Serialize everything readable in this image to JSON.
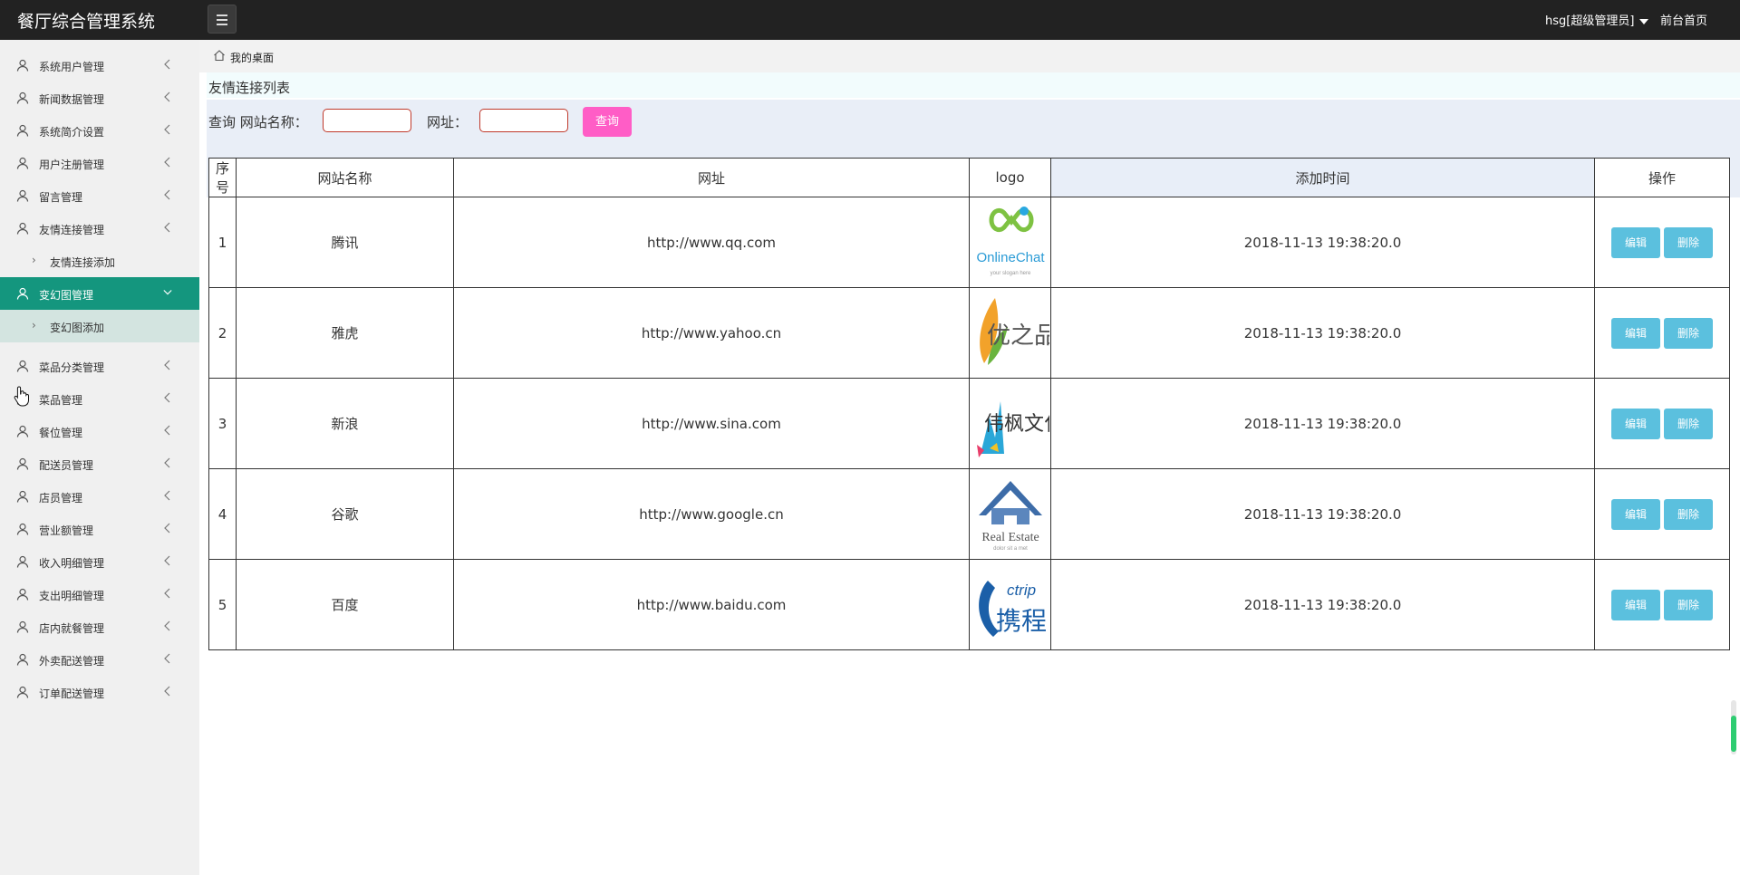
{
  "app": {
    "title": "餐厅综合管理系统"
  },
  "header": {
    "user_label": "hsg[超级管理员]",
    "home_link": "前台首页"
  },
  "sidebar": {
    "items": [
      {
        "label": "系统用户管理"
      },
      {
        "label": "新闻数据管理"
      },
      {
        "label": "系统简介设置"
      },
      {
        "label": "用户注册管理"
      },
      {
        "label": "留言管理"
      },
      {
        "label": "友情连接管理"
      },
      {
        "label": "友情连接添加",
        "sub": true
      },
      {
        "label": "变幻图管理",
        "active": true
      },
      {
        "label": "变幻图添加",
        "sub": true
      },
      {
        "label": "菜品分类管理"
      },
      {
        "label": "菜品管理"
      },
      {
        "label": "餐位管理"
      },
      {
        "label": "配送员管理"
      },
      {
        "label": "店员管理"
      },
      {
        "label": "营业额管理"
      },
      {
        "label": "收入明细管理"
      },
      {
        "label": "支出明细管理"
      },
      {
        "label": "店内就餐管理"
      },
      {
        "label": "外卖配送管理"
      },
      {
        "label": "订单配送管理"
      }
    ]
  },
  "breadcrumb": {
    "label": "我的桌面"
  },
  "list": {
    "title": "友情连接列表"
  },
  "search": {
    "prefix": "查询 网站名称：",
    "url_label": "网址：",
    "button": "查询"
  },
  "table": {
    "headers": [
      "序号",
      "网站名称",
      "网址",
      "logo",
      "添加时间",
      "操作"
    ],
    "rows": [
      {
        "no": "1",
        "name": "腾讯",
        "url": "http://www.qq.com",
        "logo": "OnlineChat",
        "time": "2018-11-13 19:38:20.0"
      },
      {
        "no": "2",
        "name": "雅虎",
        "url": "http://www.yahoo.cn",
        "logo": "优之品",
        "time": "2018-11-13 19:38:20.0"
      },
      {
        "no": "3",
        "name": "新浪",
        "url": "http://www.sina.com",
        "logo": "伟枫文化",
        "time": "2018-11-13 19:38:20.0"
      },
      {
        "no": "4",
        "name": "谷歌",
        "url": "http://www.google.cn",
        "logo": "Real Estate",
        "time": "2018-11-13 19:38:20.0"
      },
      {
        "no": "5",
        "name": "百度",
        "url": "http://www.baidu.com",
        "logo": "携程",
        "time": "2018-11-13 19:38:20.0"
      }
    ],
    "edit_label": "编辑",
    "delete_label": "删除"
  },
  "colors": {
    "topbar": "#222222",
    "active_menu": "#14967e",
    "query_button": "#ff5dc6",
    "action_button": "#5bc0de"
  }
}
